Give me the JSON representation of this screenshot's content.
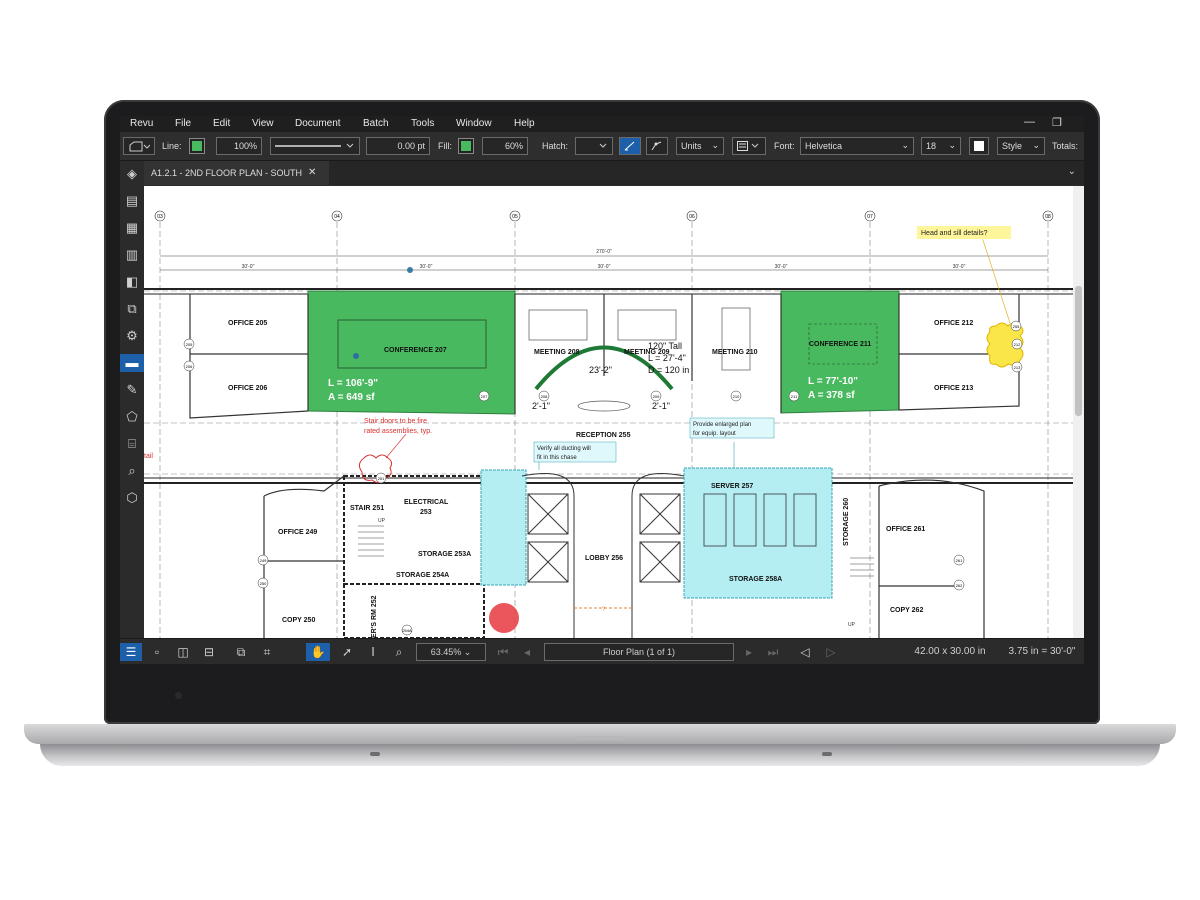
{
  "menu": [
    "Revu",
    "File",
    "Edit",
    "View",
    "Document",
    "Batch",
    "Tools",
    "Window",
    "Help"
  ],
  "window_controls": {
    "minimize": "—",
    "restore": "❐"
  },
  "toolbar": {
    "line_label": "Line:",
    "line_opacity": "100%",
    "line_width": "0.00 pt",
    "fill_label": "Fill:",
    "fill_opacity": "60%",
    "hatch_label": "Hatch:",
    "units": "Units",
    "font_label": "Font:",
    "font": "Helvetica",
    "font_size": "18",
    "style": "Style",
    "totals_label": "Totals:",
    "fill_color": "#49b95f"
  },
  "tab": {
    "title": "A1.2.1 - 2ND FLOOR PLAN - SOUTH",
    "close": "✕"
  },
  "plan": {
    "grid": [
      "03",
      "04",
      "05",
      "06",
      "07",
      "08"
    ],
    "dims": {
      "overall": "270'-0\"",
      "bay": "30'-0\""
    },
    "rooms": {
      "office205": "OFFICE 205",
      "office206": "OFFICE 206",
      "conference207": "CONFERENCE 207",
      "meeting208": "MEETING 208",
      "meeting209": "MEETING 209",
      "meeting210": "MEETING 210",
      "conference211": "CONFERENCE 211",
      "office212": "OFFICE 212",
      "office213": "OFFICE 213",
      "reception": "RECEPTION 255",
      "stair251": "STAIR 251",
      "electrical_a": "ELECTRICAL",
      "electrical_b": "253",
      "storage253a": "STORAGE 253A",
      "storage254a": "STORAGE 254A",
      "lobby": "LOBBY 256",
      "server": "SERVER 257",
      "storage258a": "STORAGE 258A",
      "storage260": "STORAGE 260",
      "office249": "OFFICE 249",
      "copy250": "COPY 250",
      "office261": "OFFICE 261",
      "copy262": "COPY 262",
      "rm252": "ER'S RM 252",
      "up": "UP"
    },
    "tags": [
      "205",
      "206",
      "207",
      "208",
      "209",
      "210",
      "211",
      "212",
      "213",
      "249",
      "250",
      "251",
      "261",
      "262",
      "254A",
      "255"
    ],
    "measures": {
      "conf207_l": "L = 106'-9\"",
      "conf207_a": "A = 649 sf",
      "conf211_l": "L = 77'-10\"",
      "conf211_a": "A = 378 sf",
      "arc_tall": "120\" Tall",
      "arc_l": "L = 27'-4\"",
      "arc_d": "D = 120 in",
      "arc_r": "23'-2\"",
      "dim_left": "2'-1\"",
      "dim_right": "2'-1\"",
      "lobby_dim": "?"
    },
    "callouts": {
      "head_sill": "Head and sill details?",
      "stair_a": "Stair doors to be fire",
      "stair_b": "rated assemblies, typ.",
      "ducting_a": "Verify all ducting will",
      "ducting_b": "fit in this chase",
      "enlarged_a": "Provide enlarged plan",
      "enlarged_b": "for equip. layout",
      "edge": "tail"
    }
  },
  "status": {
    "zoom": "63.45%",
    "page": "Floor Plan (1 of 1)",
    "size": "42.00 x 30.00 in",
    "scale": "3.75 in = 30'-0\""
  },
  "colors": {
    "markup_green": "#49b95f",
    "markup_cyan": "#b4eef2",
    "cloud_yellow": "#fbe64a",
    "redline": "#d9302f",
    "accent": "#1d5fa8"
  }
}
